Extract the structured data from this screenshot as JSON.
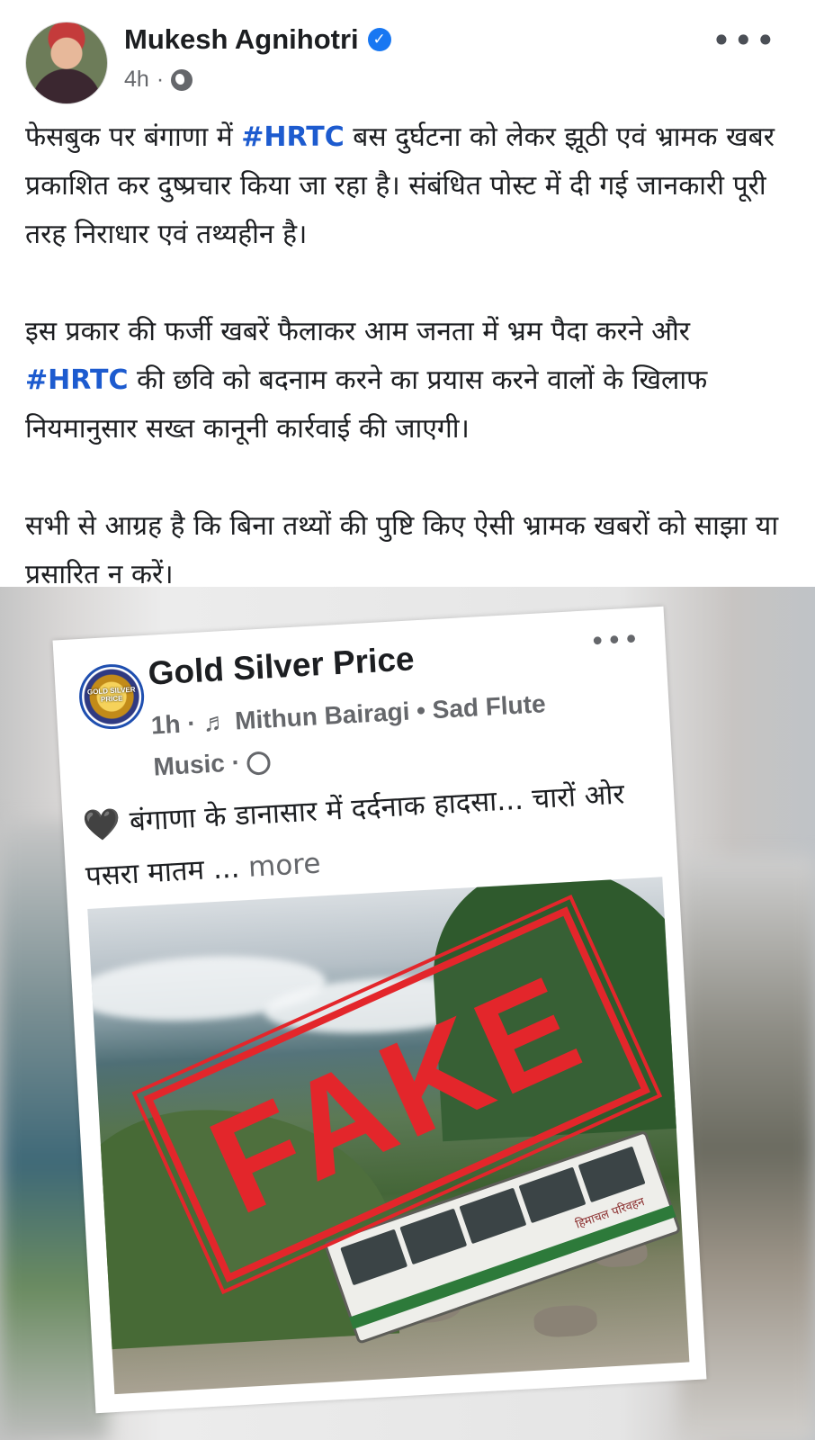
{
  "post": {
    "author": "Mukesh Agnihotri",
    "time": "4h",
    "separator": "·",
    "more_label": "•••",
    "paragraphs": [
      {
        "parts": [
          {
            "t": "फेसबुक पर बंगाणा में ",
            "h": false
          },
          {
            "t": "#HRTC",
            "h": true
          },
          {
            "t": " बस दुर्घटना को लेकर झूठी एवं भ्रामक खबर प्रकाशित कर दुष्प्रचार किया जा रहा है। संबंधित पोस्ट में दी गई जानकारी पूरी तरह निराधार एवं तथ्यहीन है।",
            "h": false
          }
        ]
      },
      {
        "parts": [
          {
            "t": "इस प्रकार की फर्जी खबरें फैलाकर आम जनता में भ्रम पैदा करने और ",
            "h": false
          },
          {
            "t": "#HRTC",
            "h": true
          },
          {
            "t": " की छवि को बदनाम करने का प्रयास करने वालों के खिलाफ नियमानुसार सख्त कानूनी कार्रवाई की जाएगी।",
            "h": false
          }
        ]
      },
      {
        "parts": [
          {
            "t": "सभी से आग्रह है कि बिना तथ्यों की पुष्टि किए ऐसी भ्रामक खबरों को साझा या प्रसारित न करें।",
            "h": false
          }
        ]
      }
    ]
  },
  "shared": {
    "page_name": "Gold Silver Price",
    "logo_text": "GOLD SILVER PRICE",
    "time": "1h",
    "music_prefix": "· ♬",
    "music": "Mithun Bairagi • Sad Flute Music ·",
    "more_label": "•••",
    "heart": "🖤",
    "text": " बंगाणा के डानासार में दर्दनाक हादसा... चारों ओर पसरा मातम ...",
    "see_more": " more",
    "stamp": "FAKE",
    "bus_label": "हिमाचल परिवहन"
  },
  "colors": {
    "hashtag": "#1d5bcf",
    "verified": "#1877f2",
    "stamp": "#e3262b"
  }
}
